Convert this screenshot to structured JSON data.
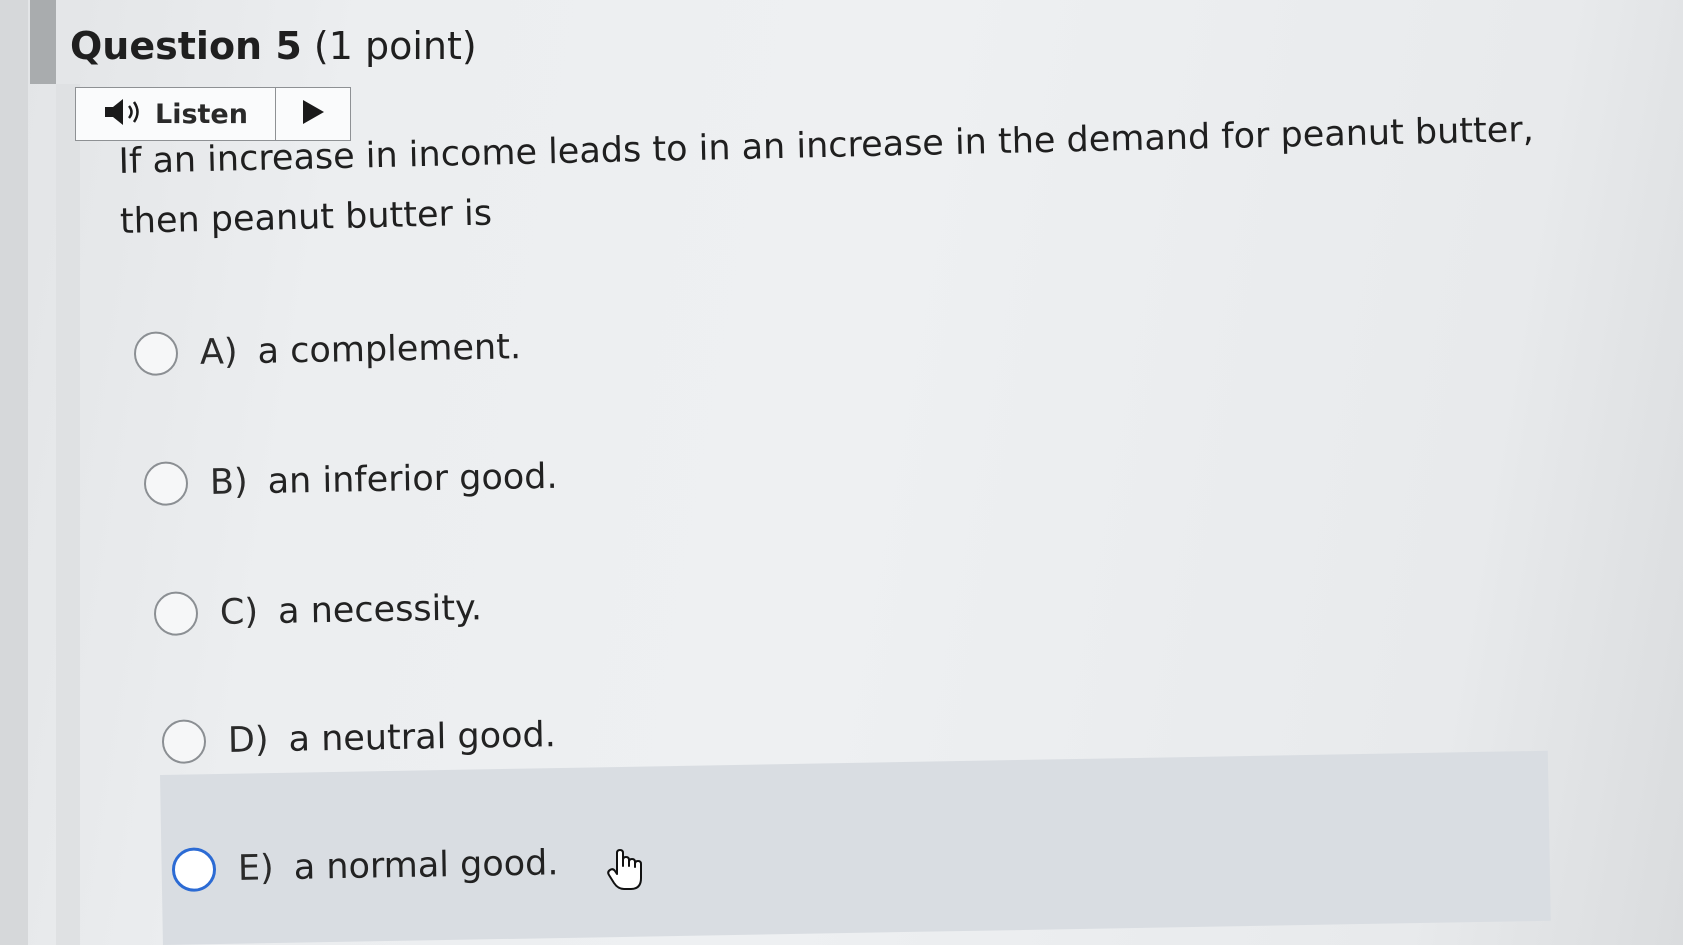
{
  "question": {
    "label": "Question 5",
    "points": "(1 point)",
    "text": "If an increase in income leads to in an increase in the demand for peanut butter, then peanut butter is"
  },
  "listen": {
    "label": "Listen",
    "speaker_icon": "speaker-icon",
    "play_icon": "play-icon"
  },
  "options": [
    {
      "letter": "A)",
      "text": "a complement."
    },
    {
      "letter": "B)",
      "text": "an inferior good."
    },
    {
      "letter": "C)",
      "text": "a necessity."
    },
    {
      "letter": "D)",
      "text": "a neutral good."
    },
    {
      "letter": "E)",
      "text": "a normal good."
    }
  ],
  "colors": {
    "focus_ring": "#2c6bd4",
    "hover_band": "#d9dde2"
  },
  "cursor_icon": "hand-pointer-icon"
}
